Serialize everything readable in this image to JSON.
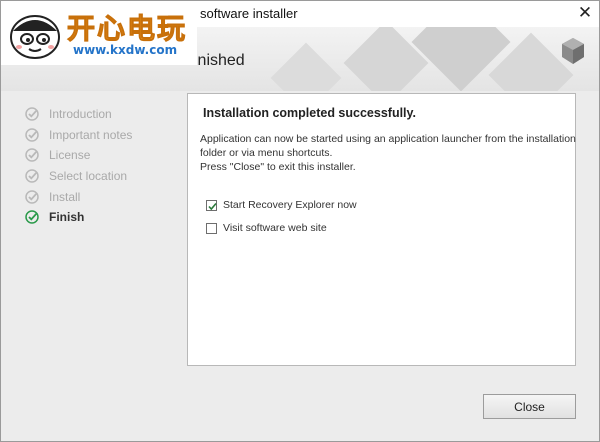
{
  "window": {
    "title": "software installer",
    "close_glyph": "✕"
  },
  "header": {
    "title": "inished"
  },
  "watermark": {
    "chinese": "开心电玩",
    "url": "www.kxdw.com"
  },
  "steps": [
    {
      "label": "Introduction",
      "done": true
    },
    {
      "label": "Important notes",
      "done": true
    },
    {
      "label": "License",
      "done": true
    },
    {
      "label": "Select location",
      "done": true
    },
    {
      "label": "Install",
      "done": true
    },
    {
      "label": "Finish",
      "done": true,
      "active": true
    }
  ],
  "content": {
    "heading": "Installation completed successfully.",
    "text_line1": "Application can now be started using an application launcher from the installation",
    "text_line2": "folder or via menu shortcuts.",
    "text_line3": "Press \"Close\" to exit this installer.",
    "options": [
      {
        "label": "Start Recovery Explorer now",
        "checked": true
      },
      {
        "label": "Visit software web site",
        "checked": false
      }
    ]
  },
  "footer": {
    "close_label": "Close"
  },
  "colors": {
    "accent": "#2a9a4a",
    "check_muted": "#b9b9b9"
  }
}
